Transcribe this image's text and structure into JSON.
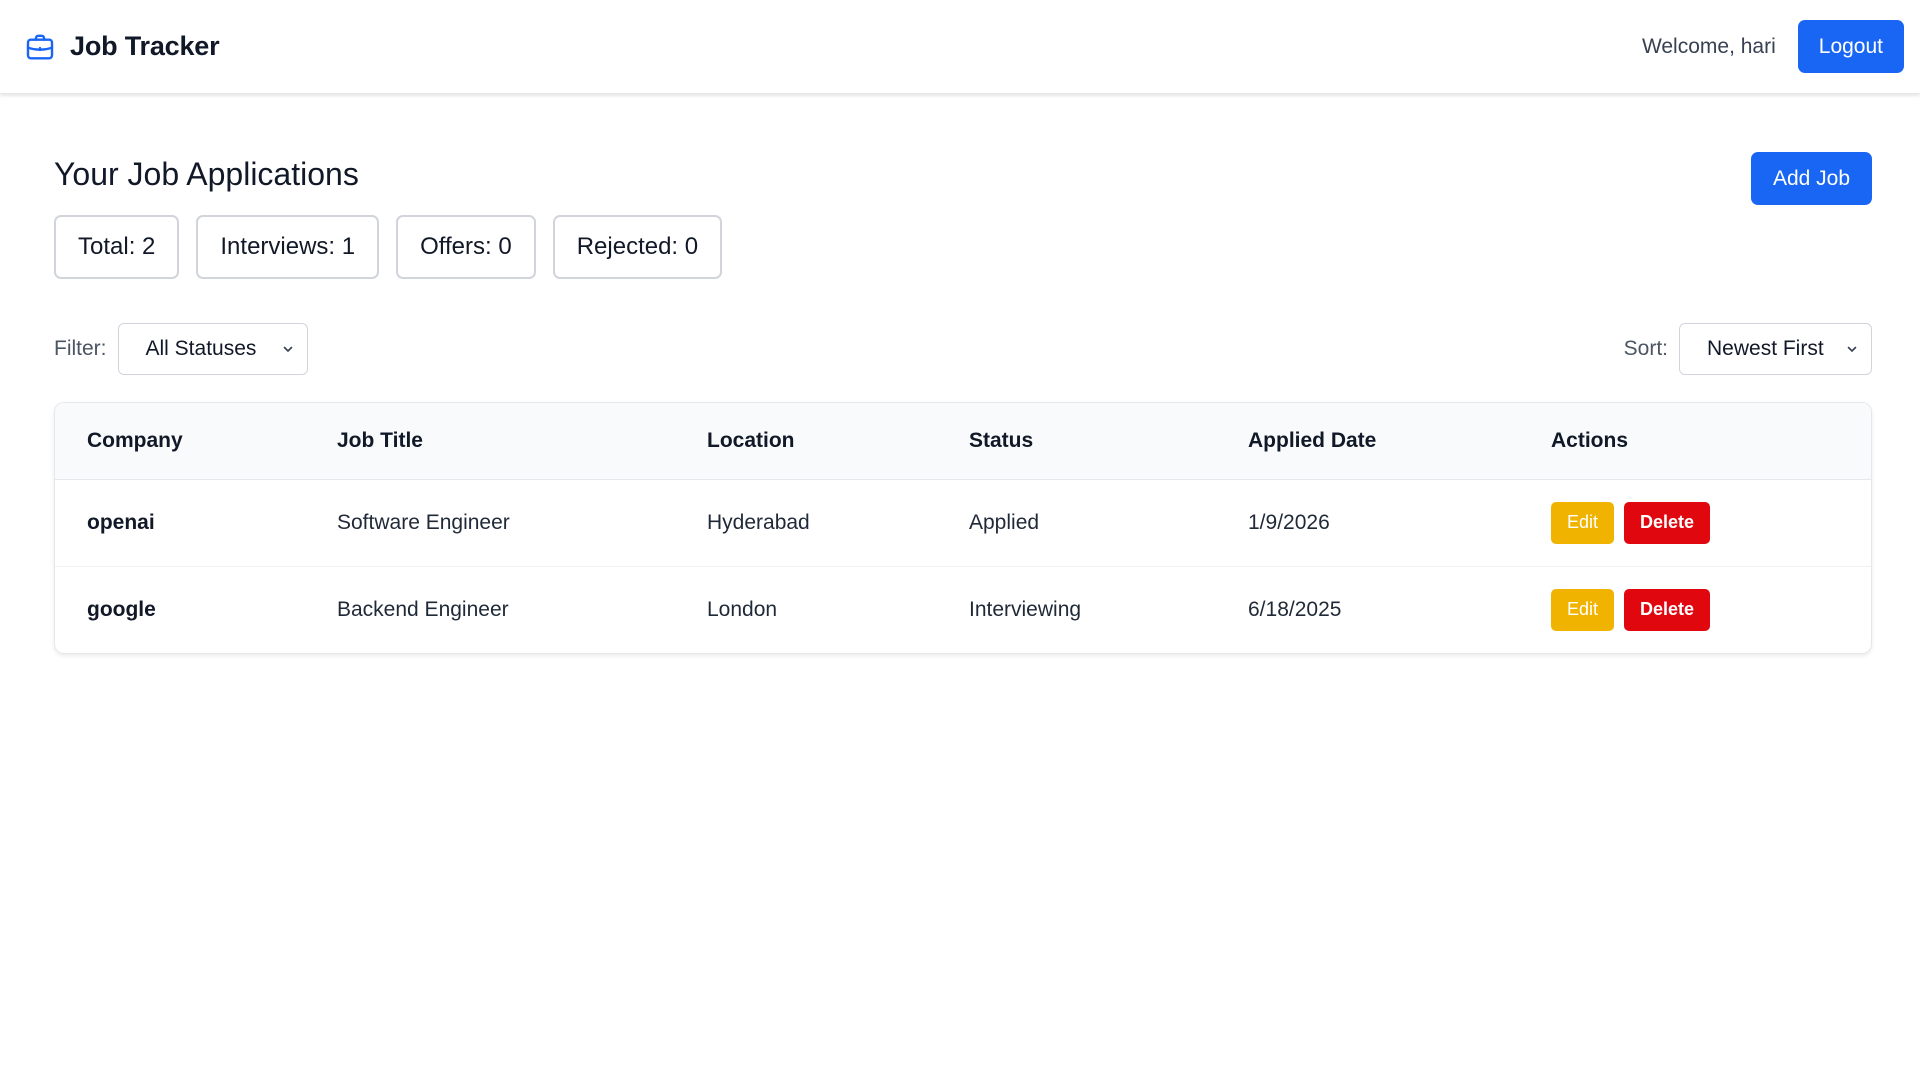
{
  "header": {
    "title": "Job Tracker",
    "icon": "briefcase-icon",
    "welcome": "Welcome, hari",
    "logout_label": "Logout"
  },
  "main": {
    "title": "Your Job Applications",
    "add_job_label": "Add Job",
    "stats": {
      "total": "Total: 2",
      "interviews": "Interviews: 1",
      "offers": "Offers: 0",
      "rejected": "Rejected: 0"
    },
    "filter": {
      "label": "Filter:",
      "value": "All Statuses"
    },
    "sort": {
      "label": "Sort:",
      "value": "Newest First"
    }
  },
  "table": {
    "columns": [
      "Company",
      "Job Title",
      "Location",
      "Status",
      "Applied Date",
      "Actions"
    ],
    "rows": [
      {
        "company": "openai",
        "job_title": "Software Engineer",
        "location": "Hyderabad",
        "status": "Applied",
        "applied_date": "1/9/2026",
        "edit": "Edit",
        "delete": "Delete"
      },
      {
        "company": "google",
        "job_title": "Backend Engineer",
        "location": "London",
        "status": "Interviewing",
        "applied_date": "6/18/2025",
        "edit": "Edit",
        "delete": "Delete"
      }
    ]
  },
  "colors": {
    "primary": "#1966f5",
    "edit": "#f0b400",
    "delete": "#e0070f"
  }
}
